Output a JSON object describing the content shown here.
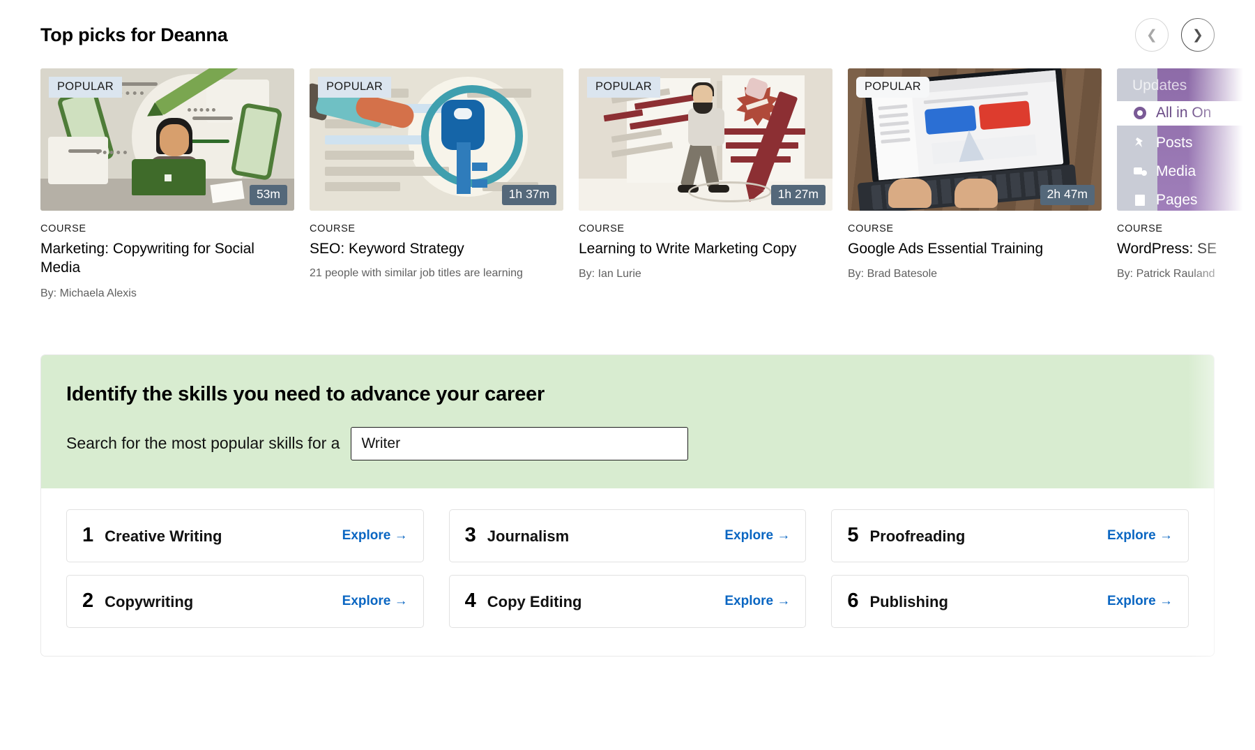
{
  "header": {
    "title": "Top picks for Deanna",
    "prev_icon": "chevron-left-icon",
    "next_icon": "chevron-right-icon"
  },
  "carousel": {
    "cards": [
      {
        "badge": "POPULAR",
        "duration": "53m",
        "kicker": "COURSE",
        "title": "Marketing: Copywriting for Social Media",
        "author": "By: Michaela Alexis",
        "subtitle": ""
      },
      {
        "badge": "POPULAR",
        "duration": "1h 37m",
        "kicker": "COURSE",
        "title": "SEO: Keyword Strategy",
        "author": "",
        "subtitle": "21 people with similar job titles are learning"
      },
      {
        "badge": "POPULAR",
        "duration": "1h 27m",
        "kicker": "COURSE",
        "title": "Learning to Write Marketing Copy",
        "author": "By: Ian Lurie",
        "subtitle": ""
      },
      {
        "badge": "POPULAR",
        "duration": "2h 47m",
        "kicker": "COURSE",
        "title": "Google Ads Essential Training",
        "author": "By: Brad Batesole",
        "subtitle": ""
      },
      {
        "badge": "",
        "duration": "",
        "kicker": "COURSE",
        "title": "WordPress: SE",
        "author": "By: Patrick Rauland",
        "subtitle": "",
        "wp_rows": [
          "Updates",
          "All in On",
          "Posts",
          "Media",
          "Pages"
        ]
      }
    ]
  },
  "skills": {
    "title": "Identify the skills you need to advance your career",
    "search_label": "Search for the most popular skills for a",
    "search_value": "Writer",
    "search_placeholder": "Writer",
    "explore_label": "Explore",
    "explore_arrow": "→",
    "items": [
      {
        "num": "1",
        "name": "Creative Writing"
      },
      {
        "num": "3",
        "name": "Journalism"
      },
      {
        "num": "5",
        "name": "Proofreading"
      },
      {
        "num": "2",
        "name": "Copywriting"
      },
      {
        "num": "4",
        "name": "Copy Editing"
      },
      {
        "num": "6",
        "name": "Publishing"
      }
    ]
  },
  "colors": {
    "badge_bg": "#dbe5ef",
    "duration_bg": "#54687a",
    "skills_header_bg": "#d8ecd0",
    "link_blue": "#0a66c2"
  }
}
